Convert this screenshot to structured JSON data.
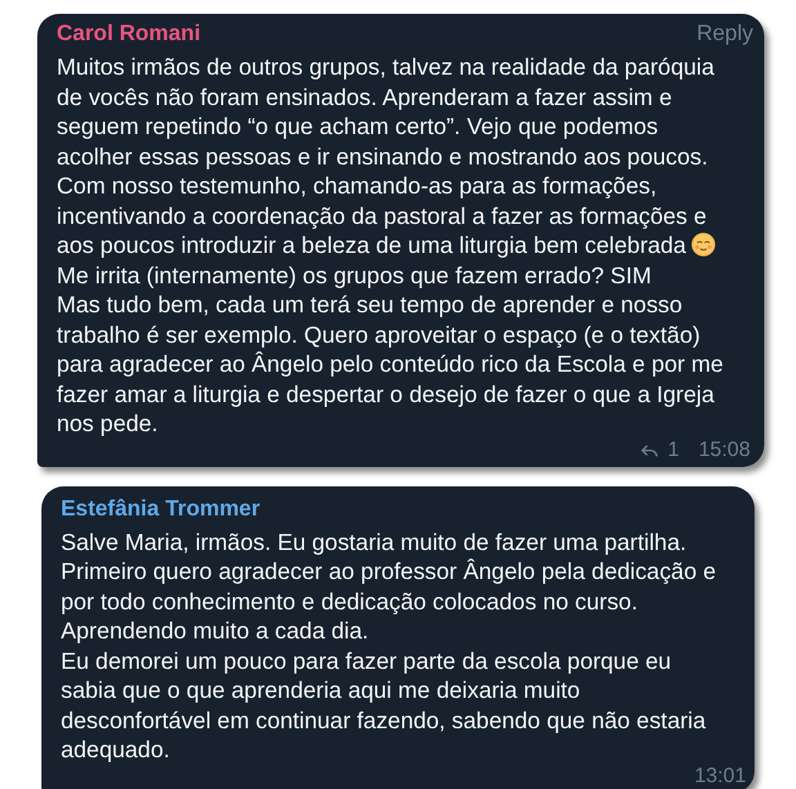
{
  "messages": [
    {
      "author": "Carol Romani",
      "color": "#e9547e",
      "reply_link": "Reply",
      "paragraphs": [
        {
          "text": "Muitos irmãos de outros grupos, talvez na realidade da paróquia de vocês não foram ensinados. Aprenderam a fazer assim e seguem repetindo “o que acham certo”. Vejo que podemos acolher essas pessoas e ir ensinando e mostrando aos poucos. Com nosso testemunho, chamando-as para as formações, incentivando a coordenação da pastoral a fazer as formações e aos poucos introduzir a beleza de uma liturgia bem celebrada",
          "emoji": true
        },
        {
          "text": "Me irrita (internamente) os grupos que fazem errado? SIM",
          "emoji": false
        },
        {
          "text": "Mas tudo bem, cada um terá seu tempo de aprender e nosso trabalho é ser exemplo. Quero aproveitar o espaço (e o textão) para agradecer ao Ângelo pelo conteúdo rico da Escola e por me fazer amar a liturgia e despertar o desejo de fazer o que a Igreja nos pede.",
          "emoji": false
        }
      ],
      "reply_count": "1",
      "time": "15:08"
    },
    {
      "author": "Estefânia Trommer",
      "color": "#5fa9e9",
      "paragraphs": [
        {
          "text": "Salve Maria, irmãos. Eu gostaria muito de fazer uma partilha. Primeiro quero agradecer ao professor Ângelo pela dedicação e por todo conhecimento e dedicação colocados no curso.",
          "emoji": false
        },
        {
          "text": "Aprendendo muito a cada dia.",
          "emoji": false
        },
        {
          "text": "Eu demorei um pouco para fazer parte da escola porque eu sabia que o que aprenderia aqui me deixaria muito desconfortável em continuar fazendo, sabendo que não estaria adequado.",
          "emoji": false
        }
      ],
      "time": "13:01"
    }
  ]
}
